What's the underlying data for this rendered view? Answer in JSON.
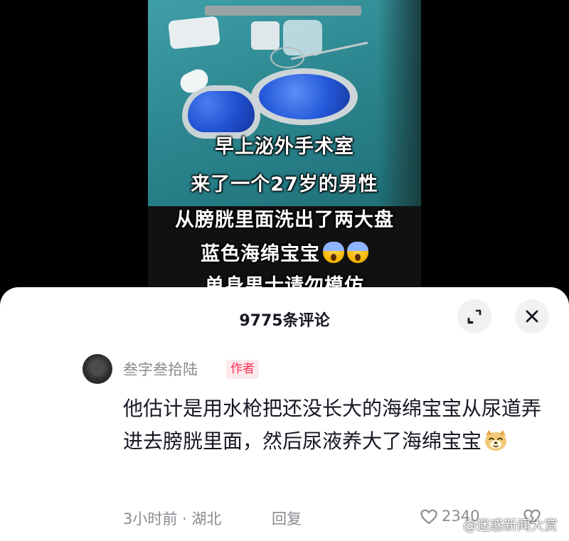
{
  "video": {
    "captions": [
      "早上泌外手术室",
      "来了一个27岁的男性",
      "从膀胱里面洗出了两大盘",
      "蓝色海绵宝宝",
      "单身男士请勿模仿"
    ],
    "caption_emoji": "scared-face-icon"
  },
  "comments_sheet": {
    "title": "9775条评论",
    "expand_icon": "expand-icon",
    "close_icon": "close-icon"
  },
  "comment": {
    "username": "叁字叁拾陆",
    "badge": "作者",
    "text": "他估计是用水枪把还没长大的海绵宝宝从尿道弄进去膀胱里面，然后尿液养大了海绵宝宝",
    "emoji": "dog-face-icon",
    "meta": "3小时前 · 湖北",
    "reply_label": "回复",
    "like_count": "2340"
  },
  "watermark": {
    "text": "@迷惑新闻大赏"
  },
  "colors": {
    "accent": "#fe2c55",
    "badge_bg": "#fde8ea",
    "muted_text": "#8a8b91",
    "primary_text": "#161823"
  }
}
